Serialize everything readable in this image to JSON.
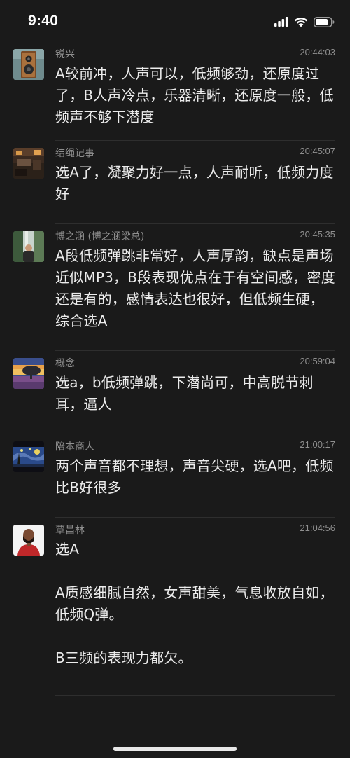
{
  "status_bar": {
    "time": "9:40",
    "icons": [
      "signal-icon",
      "wifi-icon",
      "battery-icon"
    ]
  },
  "comments": [
    {
      "user": "锐兴",
      "avatar": "speaker-avatar",
      "time": "20:44:03",
      "paragraphs": [
        "A较前冲，人声可以，低频够劲，还原度过了，B人声冷点，乐器清晰，还原度一般，低频声不够下潜度"
      ]
    },
    {
      "user": "结绳记事",
      "avatar": "studio-avatar",
      "time": "20:45:07",
      "paragraphs": [
        "选A了，凝聚力好一点，人声耐听，低频力度好"
      ]
    },
    {
      "user": "博之涵 (博之涵梁总)",
      "avatar": "person-waterfall-avatar",
      "time": "20:45:35",
      "paragraphs": [
        "A段低频弹跳非常好，人声厚韵，缺点是声场近似MP3，B段表现优点在于有空间感，密度还是有的，感情表达也很好，但低频生硬，综合选A"
      ]
    },
    {
      "user": "概念",
      "avatar": "sunset-tree-avatar",
      "time": "20:59:04",
      "paragraphs": [
        "选a，b低频弹跳，下潜尚可，中高脱节刺耳，逼人"
      ]
    },
    {
      "user": "陪本商人",
      "avatar": "starry-night-avatar",
      "time": "21:00:17",
      "paragraphs": [
        "两个声音都不理想，声音尖硬，选A吧，低频比B好很多"
      ]
    },
    {
      "user": "覃昌林",
      "avatar": "bearded-man-avatar",
      "time": "21:04:56",
      "paragraphs": [
        "选A",
        "A质感细腻自然，女声甜美，气息收放自如，低频Q弹。",
        "B三频的表现力都欠。"
      ]
    }
  ],
  "colors": {
    "background": "#1a1a1a",
    "text": "#ececec",
    "meta": "#8f8f8f",
    "divider": "#2e2e2e"
  }
}
